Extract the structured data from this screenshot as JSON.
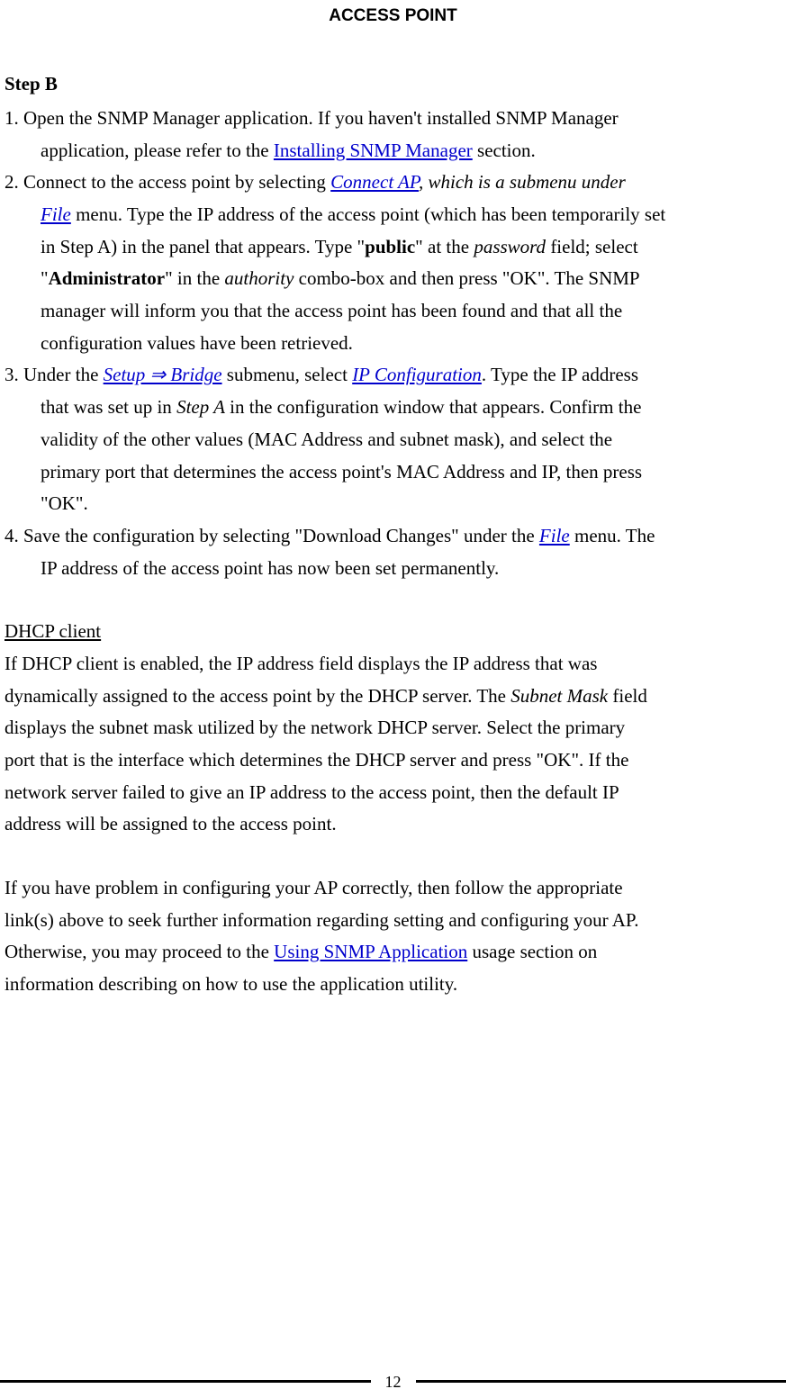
{
  "header": {
    "title": "ACCESS POINT"
  },
  "step": {
    "label": "Step B"
  },
  "items": [
    {
      "num": "1. ",
      "pre": "Open the SNMP Manager application. If you haven't installed SNMP Manager",
      "line2a": "application, please refer to the ",
      "link1": "Installing SNMP Manager",
      "line2b": " section."
    },
    {
      "num": "2. ",
      "pre": "Connect to the access point by selecting ",
      "link_connect": "Connect AP",
      "after_connect": ", which is a submenu under",
      "l2_link_file": "File",
      "l2_text": " menu. Type the IP address of the access point (which has been temporarily set",
      "l3a": "in Step A) in the panel that appears. Type \"",
      "l3_bold": "public",
      "l3b": "\" at the ",
      "l3_it": "password",
      "l3c": " field; select",
      "l4a": "\"",
      "l4_bold": "Administrator",
      "l4b": "\" in the ",
      "l4_it": "authority",
      "l4c": " combo-box and then press \"OK\". The SNMP",
      "l5": "manager will inform you that the access point has been found and that all the",
      "l6": "configuration values have been retrieved."
    },
    {
      "num": "3. ",
      "pre": "Under the ",
      "link_setup": "Setup ⇒ Bridge",
      "mid": " submenu, select ",
      "link_ipconf": "IP Configuration",
      "after": ". Type the IP address",
      "l2a": "that was set up in ",
      "l2_it": "Step A",
      "l2b": " in the configuration window that appears. Confirm the",
      "l3": "validity of the other values (MAC Address and subnet mask), and select the",
      "l4": "primary port that determines the access point's MAC Address and IP, then press",
      "l5": "\"OK\"."
    },
    {
      "num": "4. ",
      "pre": "Save the configuration by selecting \"Download Changes\" under the ",
      "link_file": "File",
      "after": " menu. The",
      "l2": "IP address of the access point has now been set permanently."
    }
  ],
  "dhcp": {
    "heading": "DHCP client",
    "p1a": "If DHCP client is enabled, the IP address field displays the IP address that was",
    "p1b": "dynamically assigned to the access point by the DHCP server. The ",
    "p1_it": "Subnet Mask",
    "p1c": " field",
    "p1d": "displays the subnet mask utilized by the network DHCP server. Select the primary",
    "p1e": "port that is the interface which determines the DHCP server and press \"OK\". If the",
    "p1f": "network server failed to give an IP address to the access point, then the default IP",
    "p1g": "address will be assigned to the access point."
  },
  "closing": {
    "l1": "If you have problem in configuring your AP correctly, then follow the appropriate",
    "l2": "link(s) above to seek further information regarding setting and configuring your AP.",
    "l3a": "Otherwise, you may proceed to the ",
    "l3_link": "Using SNMP Application",
    "l3b": " usage section on",
    "l4": "information describing on how to use the application utility."
  },
  "footer": {
    "page": "12"
  }
}
